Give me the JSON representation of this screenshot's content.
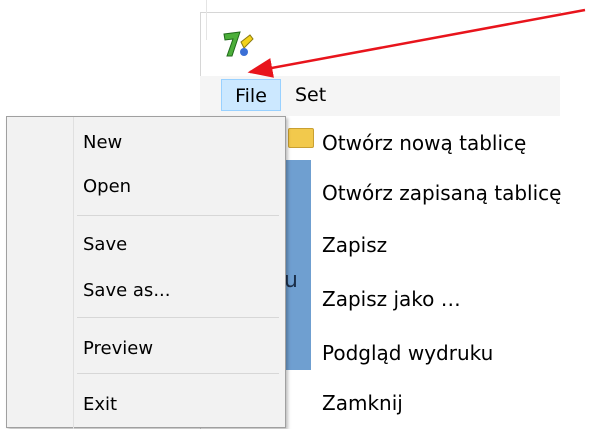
{
  "menubar": {
    "items": [
      {
        "label": "File"
      },
      {
        "label": "Set"
      }
    ]
  },
  "file_menu": {
    "items": [
      {
        "label": "New"
      },
      {
        "label": "Open"
      },
      {
        "label": "Save"
      },
      {
        "label": "Save as..."
      },
      {
        "label": "Preview"
      },
      {
        "label": "Exit"
      }
    ]
  },
  "descriptions": [
    "Otwórz nową tablicę",
    "Otwórz zapisaną tablicę",
    "Zapisz",
    "Zapisz jako …",
    "Podgląd wydruku",
    "Zamknij"
  ],
  "content_glyph": "u",
  "colors": {
    "highlight": "#cce8ff",
    "highlight_border": "#99d1ff",
    "arrow": "#e8141c",
    "logo_green": "#4caf3a",
    "logo_yellow": "#f2d21b"
  },
  "icons": {
    "app_logo": "app-logo-icon",
    "folder": "folder-icon"
  }
}
